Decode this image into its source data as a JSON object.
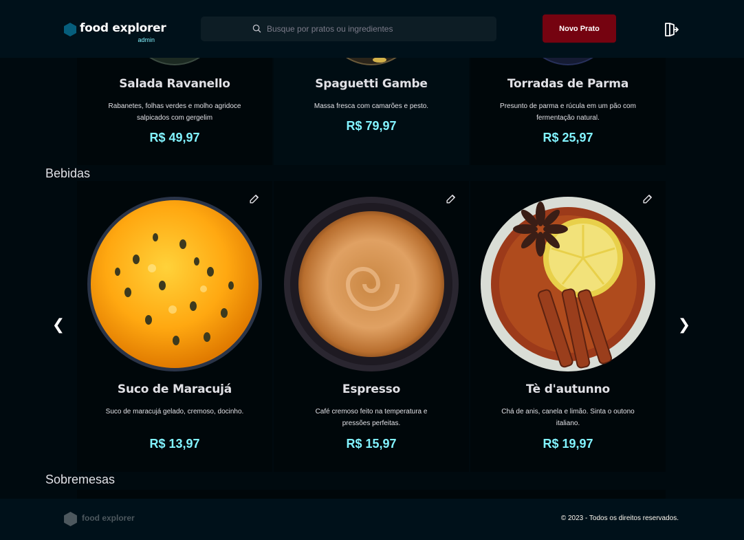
{
  "header": {
    "brand_name": "food explorer",
    "brand_role": "admin",
    "search_placeholder": "Busque por pratos ou ingredientes",
    "new_dish_label": "Novo Prato"
  },
  "colors": {
    "background": "#000A0F",
    "header": "#00111A",
    "card": "#00070A",
    "accent_cyan": "#82F3FF",
    "button_red": "#750310",
    "brand_blue": "#065E7C"
  },
  "sections": {
    "refeicoes": {
      "dishes": [
        {
          "name": "Salada Ravanello",
          "description": "Rabanetes, folhas verdes e molho agridoce salpicados com gergelim",
          "price": "R$ 49,97"
        },
        {
          "name": "Spaguetti Gambe",
          "description": "Massa fresca com camarões e pesto.",
          "price": "R$ 79,97"
        },
        {
          "name": "Torradas de Parma",
          "description": "Presunto de parma e rúcula em um pão com fermentação natural.",
          "price": "R$ 25,97"
        }
      ]
    },
    "bebidas": {
      "title": "Bebidas",
      "dishes": [
        {
          "name": "Suco de Maracujá",
          "description": "Suco de maracujá gelado, cremoso, docinho.",
          "price": "R$ 13,97",
          "image": "passion-fruit-juice"
        },
        {
          "name": "Espresso",
          "description": "Café cremoso feito na temperatura e pressões perfeitas.",
          "price": "R$ 15,97",
          "image": "espresso"
        },
        {
          "name": "Tè d'autunno",
          "description": "Chá de anis, canela e limão. Sinta o outono italiano.",
          "price": "R$ 19,97",
          "image": "autumn-tea"
        }
      ]
    },
    "sobremesas": {
      "title": "Sobremesas"
    }
  },
  "carousel": {
    "prev_icon": "chevron-left-icon",
    "next_icon": "chevron-right-icon",
    "prev_glyph": "❮",
    "next_glyph": "❯"
  },
  "footer": {
    "brand_name": "food explorer",
    "copyright": "© 2023 - Todos os direitos reservados."
  }
}
